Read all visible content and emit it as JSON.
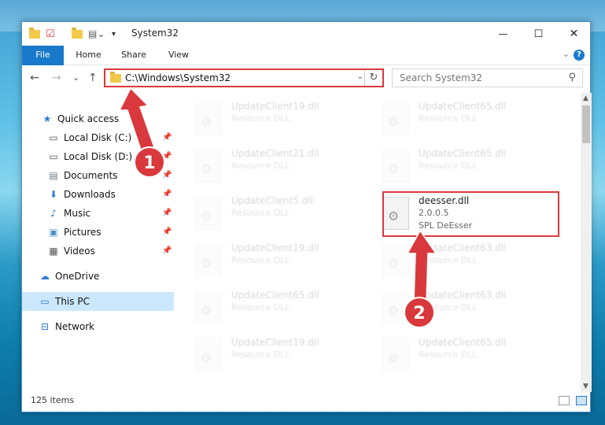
{
  "window": {
    "title": "System32",
    "minimize": "—",
    "maximize": "☐",
    "close": "✕"
  },
  "ribbon": {
    "tabs": [
      "File",
      "Home",
      "Share",
      "View"
    ],
    "help": "?"
  },
  "nav": {
    "back": "←",
    "forward": "→",
    "recent": "⌄",
    "up": "↑",
    "address": "C:\\Windows\\System32",
    "dropdown": "⌄",
    "refresh": "↻",
    "search_placeholder": "Search System32",
    "search_icon": "⚲"
  },
  "sidebar": {
    "items": [
      {
        "label": "Quick access",
        "icon": "star-icon",
        "glyph": "★",
        "color": "#2a7ad4",
        "pinned": false
      },
      {
        "label": "Local Disk (C:)",
        "icon": "drive-icon",
        "glyph": "▭",
        "color": "#555555",
        "pinned": true
      },
      {
        "label": "Local Disk (D:)",
        "icon": "drive-icon",
        "glyph": "▭",
        "color": "#555555",
        "pinned": true
      },
      {
        "label": "Documents",
        "icon": "documents-icon",
        "glyph": "▤",
        "color": "#6b7b8c",
        "pinned": true
      },
      {
        "label": "Downloads",
        "icon": "download-icon",
        "glyph": "⬇",
        "color": "#2a7ad4",
        "pinned": true
      },
      {
        "label": "Music",
        "icon": "music-icon",
        "glyph": "♪",
        "color": "#2a7ad4",
        "pinned": true
      },
      {
        "label": "Pictures",
        "icon": "pictures-icon",
        "glyph": "▣",
        "color": "#4a8fbf",
        "pinned": true
      },
      {
        "label": "Videos",
        "icon": "videos-icon",
        "glyph": "▦",
        "color": "#555555",
        "pinned": true
      },
      {
        "label": "OneDrive",
        "icon": "cloud-icon",
        "glyph": "☁",
        "color": "#2a7ad4",
        "pinned": false
      },
      {
        "label": "This PC",
        "icon": "computer-icon",
        "glyph": "▭",
        "color": "#2a7ad4",
        "pinned": false,
        "selected": true
      },
      {
        "label": "Network",
        "icon": "network-icon",
        "glyph": "⊟",
        "color": "#2a7ad4",
        "pinned": false
      }
    ]
  },
  "files": [
    {
      "name": "UpdateClient19.dll",
      "sub": "Resource DLL",
      "faded": true
    },
    {
      "name": "UpdateClient65.dll",
      "sub": "Resource DLL",
      "faded": true
    },
    {
      "name": "UpdateClient21.dll",
      "sub": "Resource DLL",
      "faded": true
    },
    {
      "name": "UpdateClient65.dll",
      "sub": "Resource DLL",
      "faded": true
    },
    {
      "name": "UpdateClient5.dll",
      "sub": "Resource DLL",
      "faded": true
    },
    {
      "name": "deesser.dll",
      "sub": "2.0.0.5",
      "sub2": "SPL DeEsser",
      "faded": false
    },
    {
      "name": "UpdateClient19.dll",
      "sub": "Resource DLL",
      "faded": true
    },
    {
      "name": "UpdateClient63.dll",
      "sub": "Resource DLL",
      "faded": true
    },
    {
      "name": "UpdateClient65.dll",
      "sub": "Resource DLL",
      "faded": true
    },
    {
      "name": "UpdateClient63.dll",
      "sub": "Resource DLL",
      "faded": true
    },
    {
      "name": "UpdateClient19.dll",
      "sub": "Resource DLL",
      "faded": true
    },
    {
      "name": "UpdateClient65.dll",
      "sub": "Resource DLL",
      "faded": true
    }
  ],
  "status": {
    "count": "125 items"
  },
  "callouts": [
    "1",
    "2"
  ],
  "colors": {
    "accent": "#1979ca",
    "highlight": "#d9393c"
  }
}
